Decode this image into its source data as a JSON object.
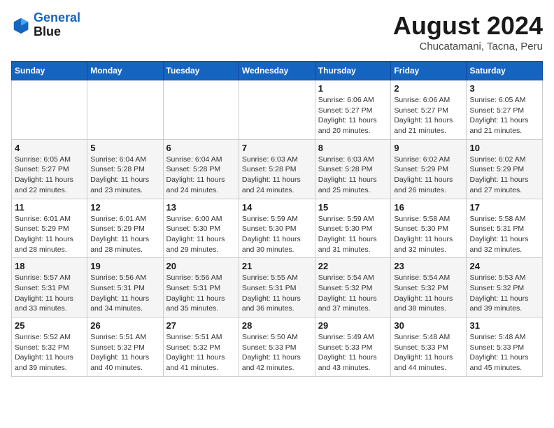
{
  "header": {
    "logo_line1": "General",
    "logo_line2": "Blue",
    "title": "August 2024",
    "subtitle": "Chucatamani, Tacna, Peru"
  },
  "weekdays": [
    "Sunday",
    "Monday",
    "Tuesday",
    "Wednesday",
    "Thursday",
    "Friday",
    "Saturday"
  ],
  "weeks": [
    [
      {
        "day": "",
        "info": ""
      },
      {
        "day": "",
        "info": ""
      },
      {
        "day": "",
        "info": ""
      },
      {
        "day": "",
        "info": ""
      },
      {
        "day": "1",
        "info": "Sunrise: 6:06 AM\nSunset: 5:27 PM\nDaylight: 11 hours and 20 minutes."
      },
      {
        "day": "2",
        "info": "Sunrise: 6:06 AM\nSunset: 5:27 PM\nDaylight: 11 hours and 21 minutes."
      },
      {
        "day": "3",
        "info": "Sunrise: 6:05 AM\nSunset: 5:27 PM\nDaylight: 11 hours and 21 minutes."
      }
    ],
    [
      {
        "day": "4",
        "info": "Sunrise: 6:05 AM\nSunset: 5:27 PM\nDaylight: 11 hours and 22 minutes."
      },
      {
        "day": "5",
        "info": "Sunrise: 6:04 AM\nSunset: 5:28 PM\nDaylight: 11 hours and 23 minutes."
      },
      {
        "day": "6",
        "info": "Sunrise: 6:04 AM\nSunset: 5:28 PM\nDaylight: 11 hours and 24 minutes."
      },
      {
        "day": "7",
        "info": "Sunrise: 6:03 AM\nSunset: 5:28 PM\nDaylight: 11 hours and 24 minutes."
      },
      {
        "day": "8",
        "info": "Sunrise: 6:03 AM\nSunset: 5:28 PM\nDaylight: 11 hours and 25 minutes."
      },
      {
        "day": "9",
        "info": "Sunrise: 6:02 AM\nSunset: 5:29 PM\nDaylight: 11 hours and 26 minutes."
      },
      {
        "day": "10",
        "info": "Sunrise: 6:02 AM\nSunset: 5:29 PM\nDaylight: 11 hours and 27 minutes."
      }
    ],
    [
      {
        "day": "11",
        "info": "Sunrise: 6:01 AM\nSunset: 5:29 PM\nDaylight: 11 hours and 28 minutes."
      },
      {
        "day": "12",
        "info": "Sunrise: 6:01 AM\nSunset: 5:29 PM\nDaylight: 11 hours and 28 minutes."
      },
      {
        "day": "13",
        "info": "Sunrise: 6:00 AM\nSunset: 5:30 PM\nDaylight: 11 hours and 29 minutes."
      },
      {
        "day": "14",
        "info": "Sunrise: 5:59 AM\nSunset: 5:30 PM\nDaylight: 11 hours and 30 minutes."
      },
      {
        "day": "15",
        "info": "Sunrise: 5:59 AM\nSunset: 5:30 PM\nDaylight: 11 hours and 31 minutes."
      },
      {
        "day": "16",
        "info": "Sunrise: 5:58 AM\nSunset: 5:30 PM\nDaylight: 11 hours and 32 minutes."
      },
      {
        "day": "17",
        "info": "Sunrise: 5:58 AM\nSunset: 5:31 PM\nDaylight: 11 hours and 32 minutes."
      }
    ],
    [
      {
        "day": "18",
        "info": "Sunrise: 5:57 AM\nSunset: 5:31 PM\nDaylight: 11 hours and 33 minutes."
      },
      {
        "day": "19",
        "info": "Sunrise: 5:56 AM\nSunset: 5:31 PM\nDaylight: 11 hours and 34 minutes."
      },
      {
        "day": "20",
        "info": "Sunrise: 5:56 AM\nSunset: 5:31 PM\nDaylight: 11 hours and 35 minutes."
      },
      {
        "day": "21",
        "info": "Sunrise: 5:55 AM\nSunset: 5:31 PM\nDaylight: 11 hours and 36 minutes."
      },
      {
        "day": "22",
        "info": "Sunrise: 5:54 AM\nSunset: 5:32 PM\nDaylight: 11 hours and 37 minutes."
      },
      {
        "day": "23",
        "info": "Sunrise: 5:54 AM\nSunset: 5:32 PM\nDaylight: 11 hours and 38 minutes."
      },
      {
        "day": "24",
        "info": "Sunrise: 5:53 AM\nSunset: 5:32 PM\nDaylight: 11 hours and 39 minutes."
      }
    ],
    [
      {
        "day": "25",
        "info": "Sunrise: 5:52 AM\nSunset: 5:32 PM\nDaylight: 11 hours and 39 minutes."
      },
      {
        "day": "26",
        "info": "Sunrise: 5:51 AM\nSunset: 5:32 PM\nDaylight: 11 hours and 40 minutes."
      },
      {
        "day": "27",
        "info": "Sunrise: 5:51 AM\nSunset: 5:32 PM\nDaylight: 11 hours and 41 minutes."
      },
      {
        "day": "28",
        "info": "Sunrise: 5:50 AM\nSunset: 5:33 PM\nDaylight: 11 hours and 42 minutes."
      },
      {
        "day": "29",
        "info": "Sunrise: 5:49 AM\nSunset: 5:33 PM\nDaylight: 11 hours and 43 minutes."
      },
      {
        "day": "30",
        "info": "Sunrise: 5:48 AM\nSunset: 5:33 PM\nDaylight: 11 hours and 44 minutes."
      },
      {
        "day": "31",
        "info": "Sunrise: 5:48 AM\nSunset: 5:33 PM\nDaylight: 11 hours and 45 minutes."
      }
    ]
  ]
}
